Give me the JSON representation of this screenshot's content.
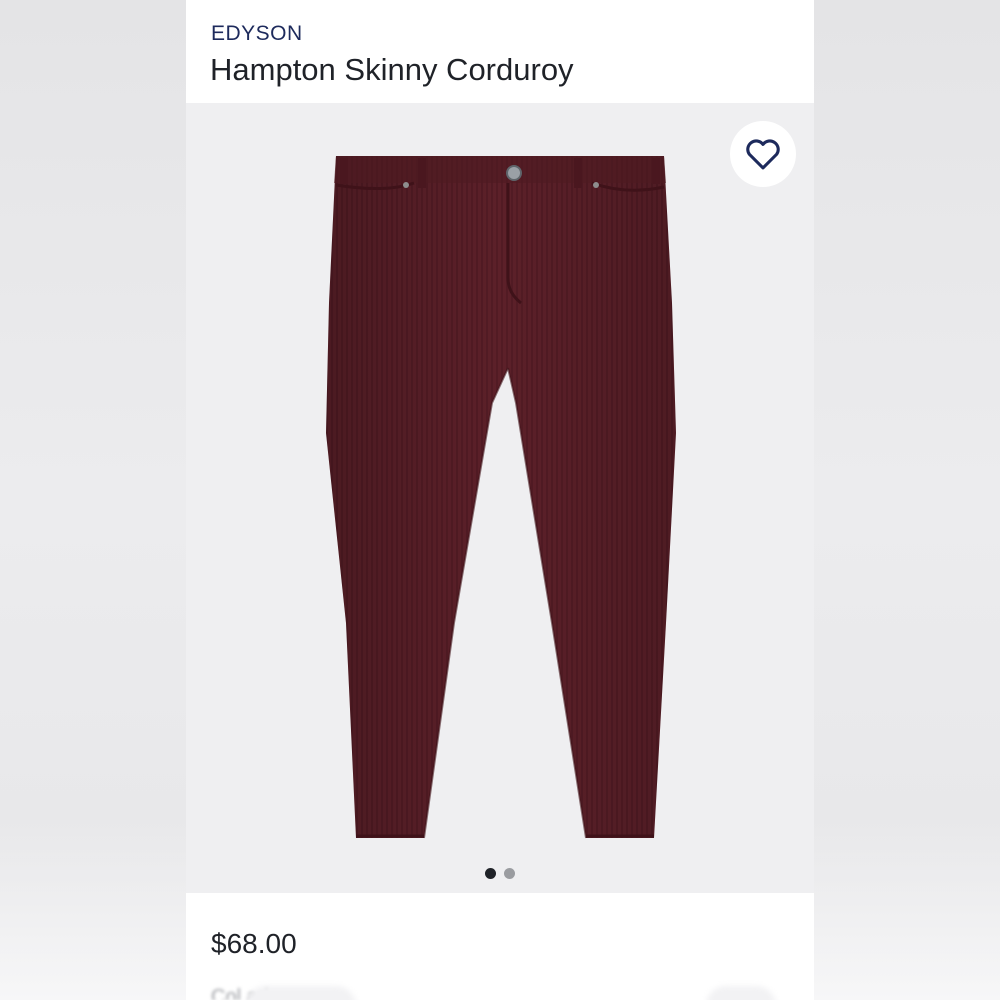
{
  "product": {
    "brand": "EDYSON",
    "name": "Hampton Skinny Corduroy",
    "price": "$68.00",
    "color_label_partial": "Col   ark"
  },
  "gallery": {
    "image_count": 2,
    "active_index": 0,
    "product_color": "#5a1f27"
  },
  "icons": {
    "favorite": "heart-outline-icon"
  },
  "colors": {
    "brand": "#1d2a5c",
    "text": "#1f2228",
    "gallery_bg": "#efeff1"
  }
}
